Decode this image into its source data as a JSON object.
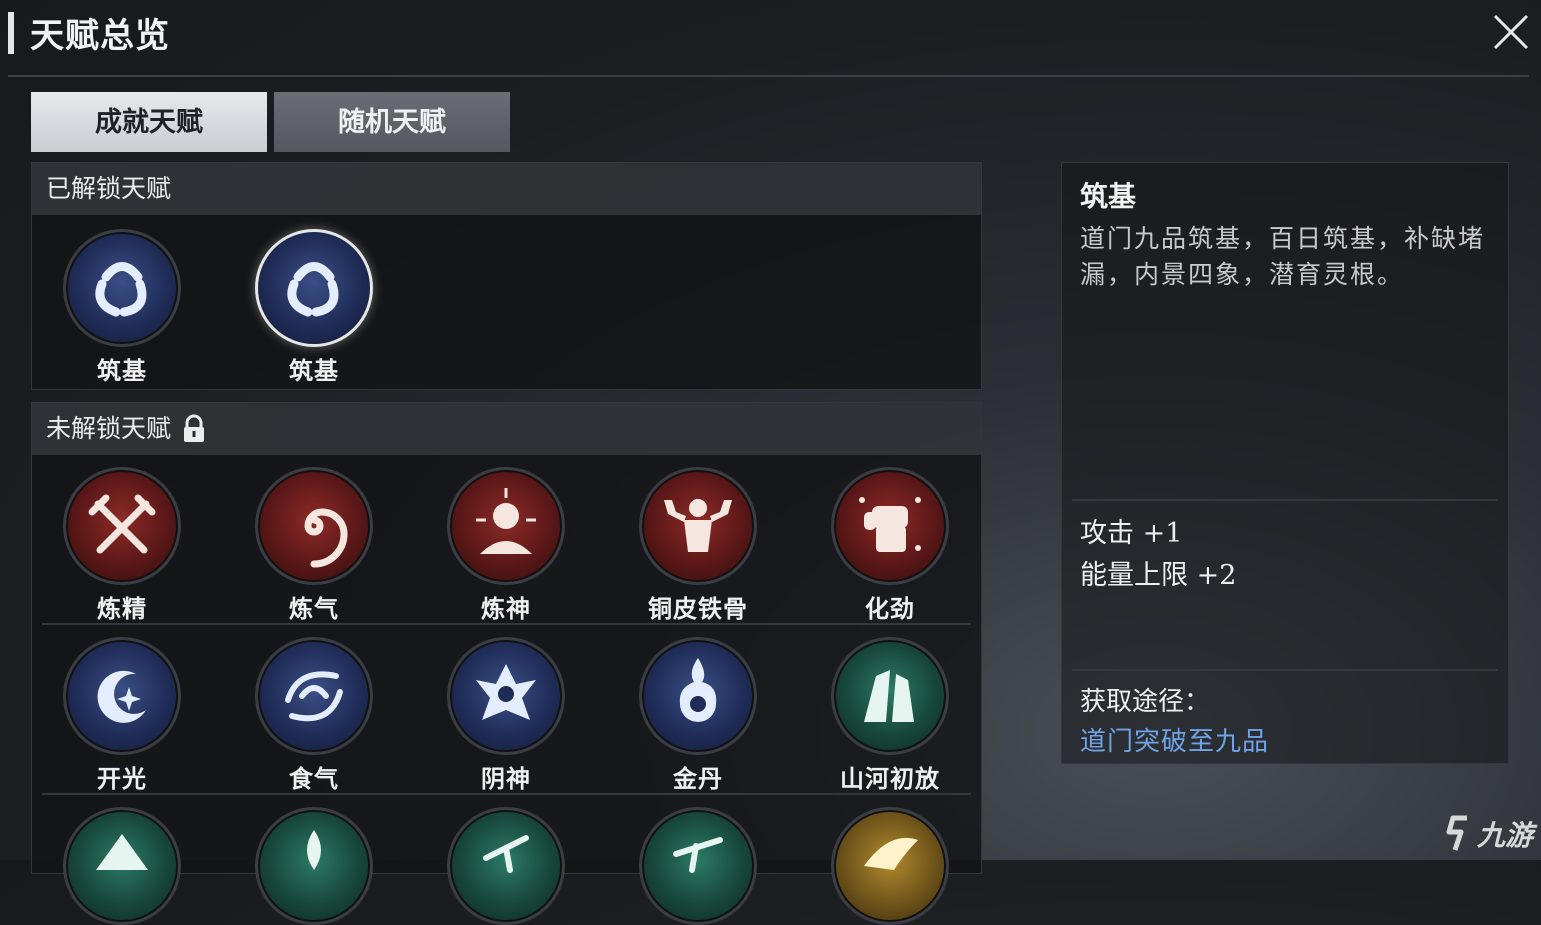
{
  "header": {
    "title": "天赋总览"
  },
  "tabs": [
    {
      "label": "成就天赋",
      "active": true
    },
    {
      "label": "随机天赋",
      "active": false
    }
  ],
  "unlocked": {
    "header": "已解锁天赋",
    "talents": [
      {
        "name": "筑基",
        "color": "blue",
        "icon": "swirl-icon"
      },
      {
        "name": "筑基",
        "color": "blue",
        "icon": "swirl-icon",
        "selected": true
      }
    ]
  },
  "locked": {
    "header": "未解锁天赋",
    "talents": [
      {
        "name": "炼精",
        "color": "red",
        "icon": "crossed-swords-icon"
      },
      {
        "name": "炼气",
        "color": "red",
        "icon": "spiral-icon"
      },
      {
        "name": "炼神",
        "color": "red",
        "icon": "meditating-figure-icon"
      },
      {
        "name": "铜皮铁骨",
        "color": "red",
        "icon": "muscle-figure-icon"
      },
      {
        "name": "化劲",
        "color": "red",
        "icon": "fist-icon"
      },
      {
        "name": "开光",
        "color": "blue",
        "icon": "crescent-star-icon"
      },
      {
        "name": "食气",
        "color": "blue",
        "icon": "vortex-icon"
      },
      {
        "name": "阴神",
        "color": "blue",
        "icon": "mask-icon"
      },
      {
        "name": "金丹",
        "color": "blue",
        "icon": "flame-orb-icon"
      },
      {
        "name": "山河初放",
        "color": "green",
        "icon": "mountain-icon"
      }
    ],
    "partial_row": [
      {
        "color": "green",
        "icon": "mountain-peak-icon"
      },
      {
        "color": "green",
        "icon": "leaf-icon"
      },
      {
        "color": "green",
        "icon": "branch-icon"
      },
      {
        "color": "green",
        "icon": "branch-icon"
      },
      {
        "color": "gold",
        "icon": "gold-emblem-icon"
      }
    ]
  },
  "detail": {
    "title": "筑基",
    "description": "道门九品筑基，百日筑基，补缺堵漏，内景四象，潜育灵根。",
    "stats": [
      "攻击 +1",
      "能量上限 +2"
    ],
    "obtain_label": "获取途径：",
    "obtain_value": "道门突破至九品"
  },
  "watermark": {
    "text": "九游"
  }
}
